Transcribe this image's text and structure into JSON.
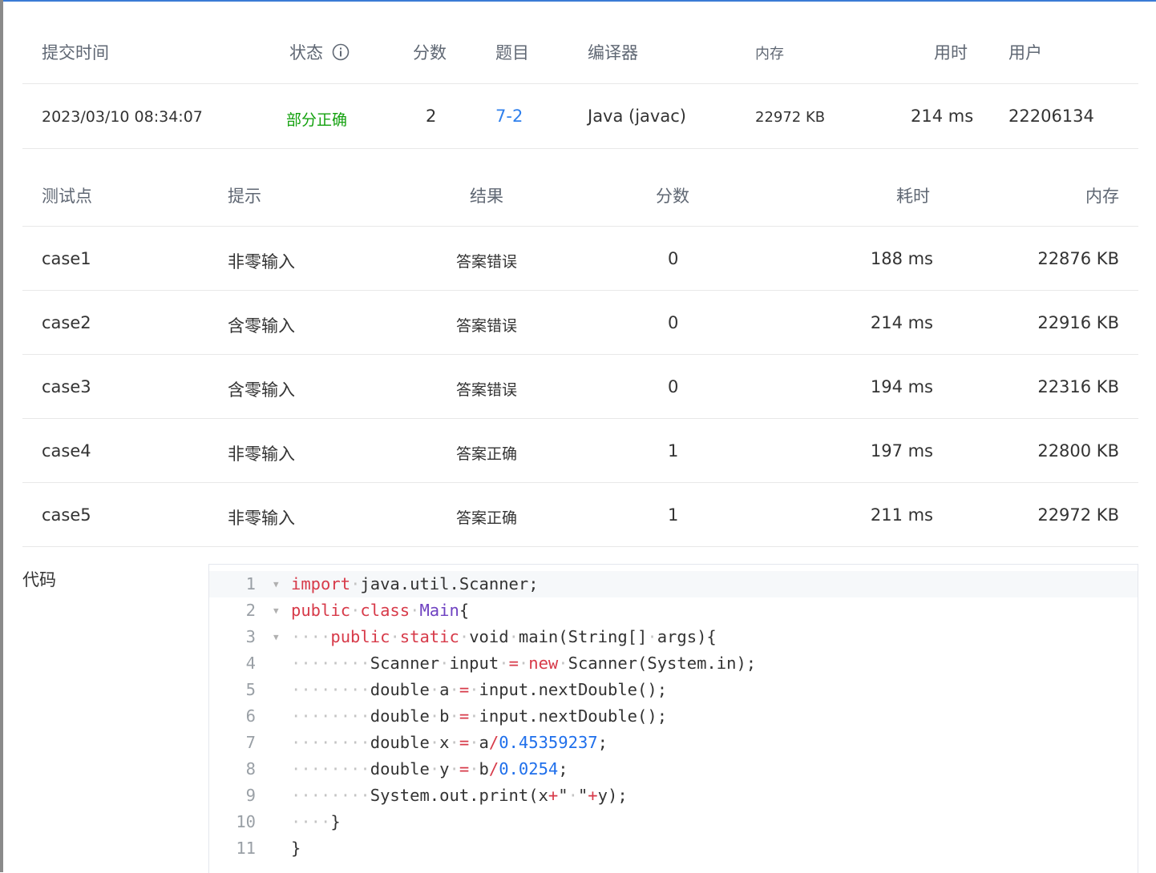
{
  "submission": {
    "headers": {
      "time": "提交时间",
      "status": "状态",
      "score": "分数",
      "problem": "题目",
      "compiler": "编译器",
      "memory": "内存",
      "duration": "用时",
      "user": "用户"
    },
    "row": {
      "time": "2023/03/10 08:34:07",
      "status": "部分正确",
      "score": "2",
      "problem": "7-2",
      "compiler": "Java (javac)",
      "memory": "22972 KB",
      "duration": "214 ms",
      "user": "22206134"
    }
  },
  "tests": {
    "headers": {
      "case": "测试点",
      "hint": "提示",
      "result": "结果",
      "score": "分数",
      "time": "耗时",
      "memory": "内存"
    },
    "rows": [
      {
        "case": "case1",
        "hint": "非零输入",
        "result": "答案错误",
        "score": "0",
        "time": "188 ms",
        "memory": "22876 KB"
      },
      {
        "case": "case2",
        "hint": "含零输入",
        "result": "答案错误",
        "score": "0",
        "time": "214 ms",
        "memory": "22916 KB"
      },
      {
        "case": "case3",
        "hint": "含零输入",
        "result": "答案错误",
        "score": "0",
        "time": "194 ms",
        "memory": "22316 KB"
      },
      {
        "case": "case4",
        "hint": "非零输入",
        "result": "答案正确",
        "score": "1",
        "time": "197 ms",
        "memory": "22800 KB"
      },
      {
        "case": "case5",
        "hint": "非零输入",
        "result": "答案正确",
        "score": "1",
        "time": "211 ms",
        "memory": "22972 KB"
      }
    ]
  },
  "code": {
    "label": "代码",
    "line_numbers": [
      "1",
      "2",
      "3",
      "4",
      "5",
      "6",
      "7",
      "8",
      "9",
      "10",
      "11"
    ],
    "lines": [
      "import java.util.Scanner;",
      "public class Main{",
      "    public static void main(String[] args){",
      "        Scanner input = new Scanner(System.in);",
      "        double a = input.nextDouble();",
      "        double b = input.nextDouble();",
      "        double x = a/0.45359237;",
      "        double y = b/0.0254;",
      "        System.out.print(x+\" \"+y);",
      "    }",
      "}"
    ]
  },
  "colors": {
    "result_wrong": "#13a10e",
    "result_correct": "#e64340",
    "status_partial": "#13a10e",
    "problem_link": "#2f80ed"
  },
  "icons": {
    "status_info": "info-circle-icon",
    "fold": "fold-triangle-icon"
  }
}
